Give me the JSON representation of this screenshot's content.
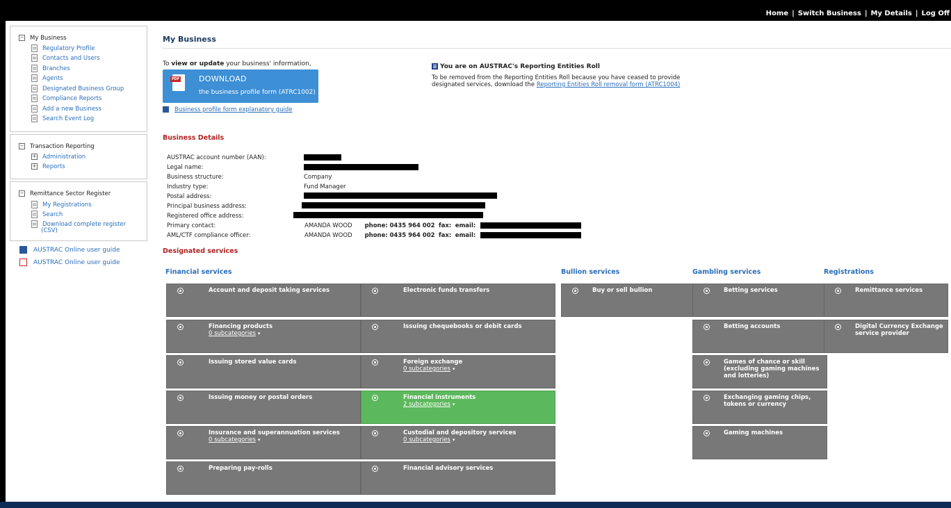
{
  "topnav": [
    "Home",
    "Switch Business",
    "My Details",
    "Log Off"
  ],
  "sidebar": {
    "my_business": {
      "title": "My Business",
      "items": [
        "Regulatory Profile",
        "Contacts and Users",
        "Branches",
        "Agents",
        "Designated Business Group",
        "Compliance Reports",
        "Add a new Business",
        "Search Event Log"
      ]
    },
    "transaction_reporting": {
      "title": "Transaction Reporting",
      "items": [
        "Administration",
        "Reports"
      ]
    },
    "remittance": {
      "title": "Remittance Sector Register",
      "items": [
        "My Registrations",
        "Search",
        "Download complete register",
        "(CSV)"
      ]
    },
    "guides": [
      "AUSTRAC Online user guide",
      "AUSTRAC Online user guide"
    ]
  },
  "main": {
    "title": "My Business",
    "intro_pre": "To ",
    "intro_bold": "view or update",
    "intro_post": " your business' information,",
    "download": {
      "badge": "PDF",
      "line1": "DOWNLOAD",
      "line2": "the business profile form (ATRC1002)"
    },
    "explanatory_link": "Business profile form explanatory guide",
    "roll": {
      "title": "You are on AUSTRAC's Reporting Entities Roll",
      "text": "To be removed from the Reporting Entities Roll because you have ceased to provide designated services, download the ",
      "link": "Reporting Entities Roll removal form (ATRC1004)"
    }
  },
  "business_details": {
    "heading": "Business Details",
    "labels": [
      "AUSTRAC account number (AAN):",
      "Legal name:",
      "Business structure:",
      "Industry type:",
      "Postal address:",
      "Principal business address:",
      "Registered office address:",
      "Primary contact:",
      "AML/CTF compliance officer:"
    ],
    "business_structure": "Company",
    "industry_type": "Fund Manager",
    "primary_contact": {
      "name": "AMANDA WOOD",
      "phone_label": "phone:",
      "phone": "0435 964 002",
      "fax_label": "fax:",
      "email_label": "email:"
    },
    "compliance_officer": {
      "name": "AMANDA WOOD",
      "phone_label": "phone:",
      "phone": "0435 964 002",
      "fax_label": "fax:",
      "email_label": "email:"
    }
  },
  "designated_services": {
    "heading": "Designated services",
    "categories": [
      "Financial services",
      "Bullion services",
      "Gambling services",
      "Registrations"
    ],
    "financial": [
      {
        "label": "Account and deposit taking services",
        "sub": ""
      },
      {
        "label": "Electronic funds transfers",
        "sub": ""
      },
      {
        "label": "Financing products",
        "sub": "0 subcategories"
      },
      {
        "label": "Issuing chequebooks or debit cards",
        "sub": ""
      },
      {
        "label": "Issuing stored value cards",
        "sub": ""
      },
      {
        "label": "Foreign exchange",
        "sub": "0 subcategories"
      },
      {
        "label": "Issuing money or postal orders",
        "sub": ""
      },
      {
        "label": "Financial instruments",
        "sub": "2 subcategories"
      },
      {
        "label": "Insurance and superannuation services",
        "sub": "0 subcategories"
      },
      {
        "label": "Custodial and depository services",
        "sub": "0 subcategories"
      },
      {
        "label": "Preparing pay-rolls",
        "sub": ""
      },
      {
        "label": "Financial advisory services",
        "sub": ""
      }
    ],
    "bullion": [
      "Buy or sell bullion"
    ],
    "gambling": [
      "Betting services",
      "Betting accounts",
      "Games of chance or skill (excluding gaming machines and lotteries)",
      "Exchanging gaming chips, tokens or currency",
      "Gaming machines"
    ],
    "registrations": [
      "Remittance services",
      "Digital Currency Exchange service provider"
    ],
    "caret": "▾"
  },
  "colors": {
    "active_service": "#5cb85c",
    "inactive_service": "#787878",
    "link": "#2a6ebb",
    "section_heading": "#b22222"
  }
}
